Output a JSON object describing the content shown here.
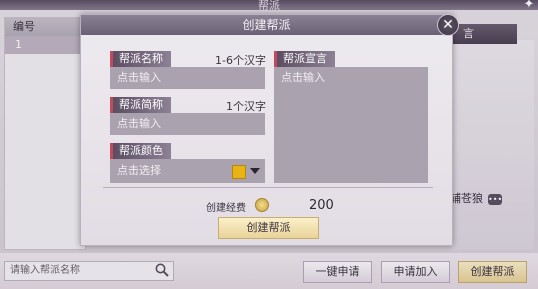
{
  "window": {
    "title": "帮派"
  },
  "table": {
    "header": "编号",
    "rows": [
      "1"
    ]
  },
  "declaration_tab": "言",
  "leader_text": "辅苍狼",
  "bottom": {
    "search_placeholder": "请输入帮派名称",
    "one_click_apply": "一键申请",
    "apply_join": "申请加入",
    "create_guild": "创建帮派"
  },
  "modal": {
    "title": "创建帮派",
    "name": {
      "label": "帮派名称",
      "hint": "1-6个汉字",
      "placeholder": "点击输入"
    },
    "short_name": {
      "label": "帮派简称",
      "hint": "1个汉字",
      "placeholder": "点击输入"
    },
    "color": {
      "label": "帮派颜色",
      "placeholder": "点击选择",
      "swatch": "#e8b314"
    },
    "declaration": {
      "label": "帮派宣言",
      "placeholder": "点击输入"
    },
    "cost_label": "创建经费",
    "cost_value": "200",
    "confirm": "创建帮派"
  },
  "colors": {
    "accent_gold": "#e9d39a",
    "tab_marker": "#c24a5a",
    "header": "#6b6174"
  }
}
